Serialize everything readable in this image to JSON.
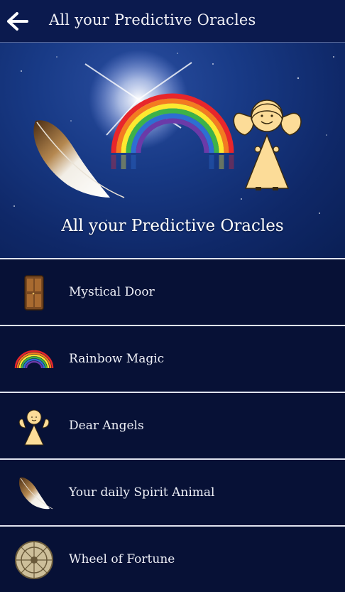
{
  "appbar": {
    "title": "All your Predictive Oracles",
    "back_icon": "arrow-left-icon"
  },
  "hero": {
    "caption": "All your Predictive Oracles"
  },
  "list": {
    "items": [
      {
        "label": "Mystical Door",
        "icon": "door-icon"
      },
      {
        "label": "Rainbow Magic",
        "icon": "rainbow-icon"
      },
      {
        "label": "Dear Angels",
        "icon": "angel-icon"
      },
      {
        "label": "Your daily Spirit Animal",
        "icon": "feather-icon"
      },
      {
        "label": "Wheel of Fortune",
        "icon": "wheel-icon"
      }
    ]
  },
  "colors": {
    "appbar": "#0b1a4e",
    "list_bg": "#071136",
    "divider": "#dfe3ee",
    "text": "#eef0f7"
  }
}
